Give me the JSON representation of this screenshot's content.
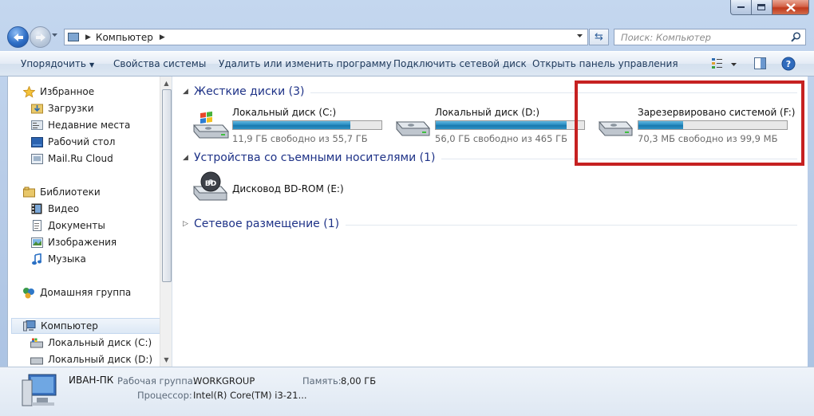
{
  "window": {
    "address": {
      "path": "Компьютер"
    },
    "search": {
      "placeholder": "Поиск: Компьютер"
    }
  },
  "toolbar": {
    "organize": "Упорядочить",
    "system_properties": "Свойства системы",
    "uninstall": "Удалить или изменить программу",
    "map_drive": "Подключить сетевой диск",
    "control_panel": "Открыть панель управления"
  },
  "nav": {
    "favorites": "Избранное",
    "downloads": "Загрузки",
    "recent": "Недавние места",
    "desktop": "Рабочий стол",
    "mailru": "Mail.Ru Cloud",
    "libraries": "Библиотеки",
    "video": "Видео",
    "documents": "Документы",
    "pictures": "Изображения",
    "music": "Музыка",
    "homegroup": "Домашняя группа",
    "computer": "Компьютер",
    "disk_c": "Локальный диск (C:)",
    "disk_d": "Локальный диск (D:)"
  },
  "groups": {
    "hard_disks": "Жесткие диски (3)",
    "removable": "Устройства со съемными носителями (1)",
    "network": "Сетевое размещение (1)"
  },
  "drives": [
    {
      "name": "Локальный диск (C:)",
      "free": "11,9 ГБ свободно из 55,7 ГБ",
      "used_fraction": 0.79
    },
    {
      "name": "Локальный диск (D:)",
      "free": "56,0 ГБ свободно из 465 ГБ",
      "used_fraction": 0.88
    },
    {
      "name": "Зарезервировано системой (F:)",
      "free": "70,3 МБ свободно из 99,9 МБ",
      "used_fraction": 0.3
    }
  ],
  "bd_drive": {
    "name": "Дисковод BD-ROM (E:)",
    "badge": "BD"
  },
  "details": {
    "pc_name": "ИВАН-ПК",
    "workgroup_label": "Рабочая группа:",
    "workgroup_value": "WORKGROUP",
    "memory_label": "Память:",
    "memory_value": "8,00 ГБ",
    "cpu_label": "Процессор:",
    "cpu_value": "Intel(R) Core(TM) i3-21..."
  },
  "colors": {
    "highlight": "#c62121",
    "bar_fill": "#2a8ec2",
    "group_title": "#1e3287"
  }
}
